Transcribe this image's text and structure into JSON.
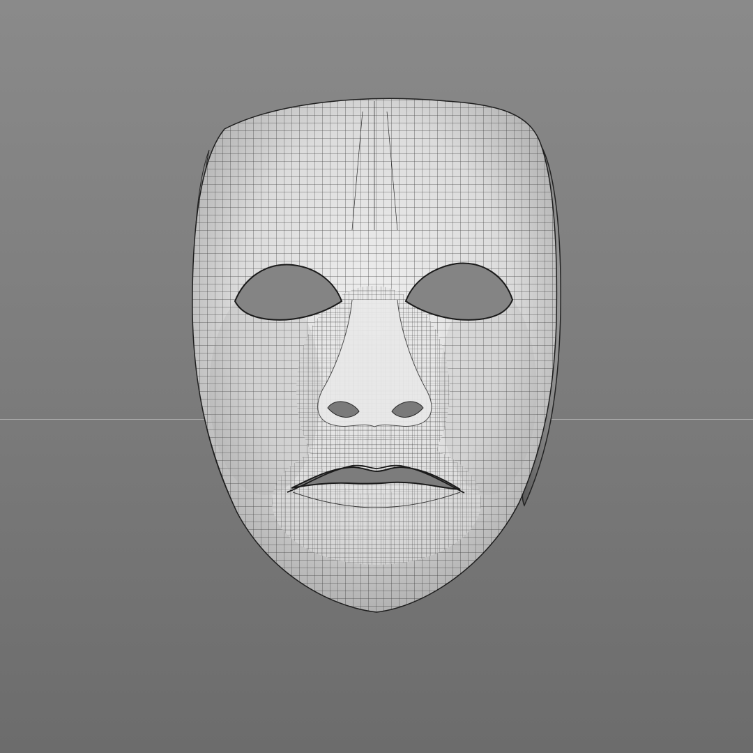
{
  "viewport": {
    "background_top": "#8a8a8a",
    "background_bottom": "#6c6c6c",
    "horizon_color": "#b4b4b4"
  },
  "model": {
    "object": "face-mask",
    "display": "wireframe-on-shaded",
    "surface_color": "#e2e2e2",
    "wire_color": "#2a2a2a"
  }
}
